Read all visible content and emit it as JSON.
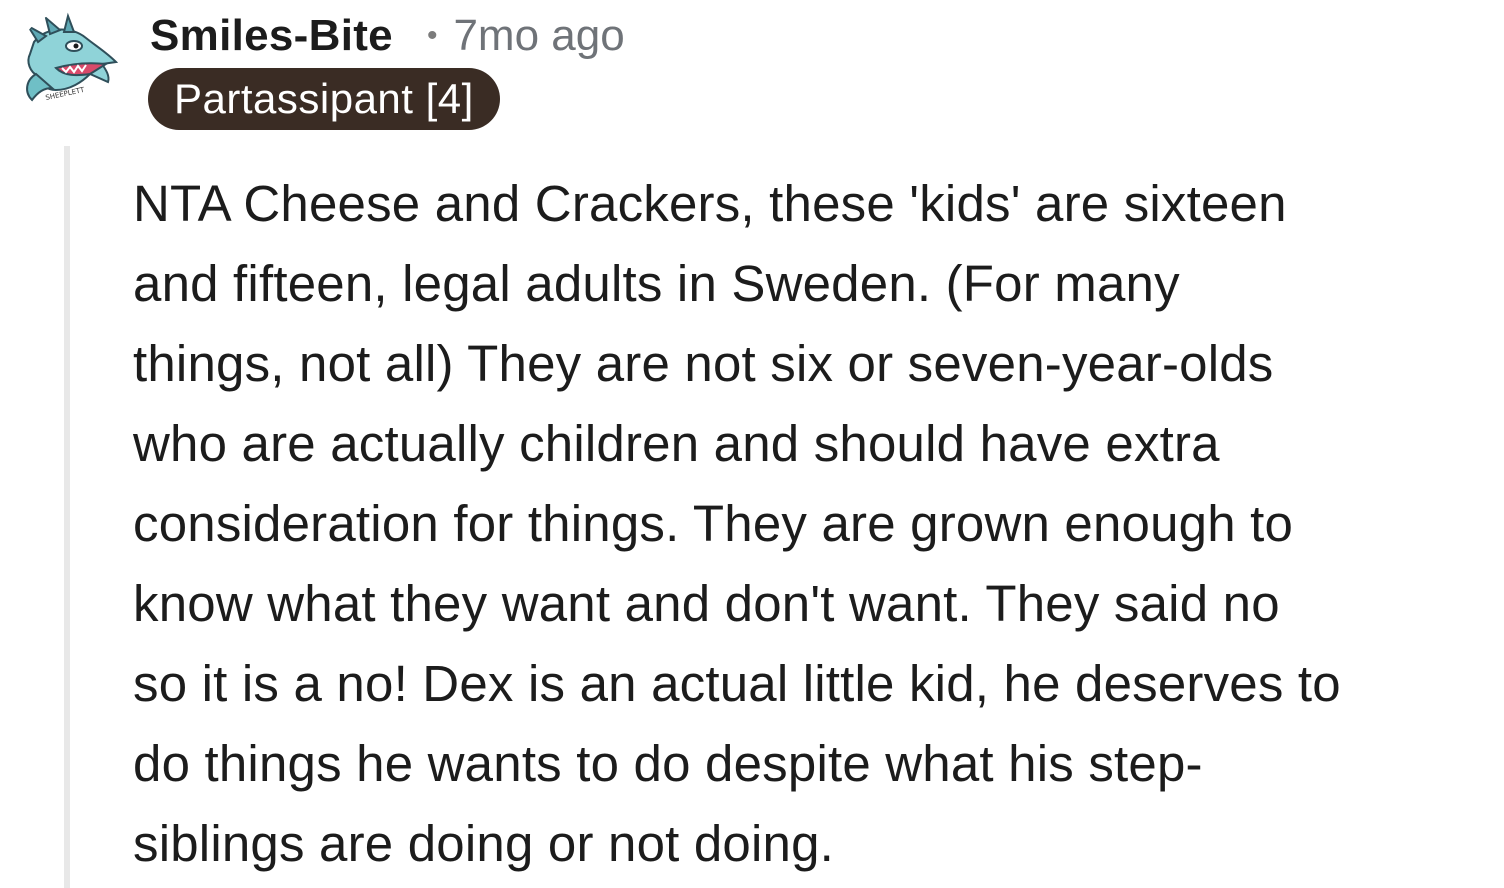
{
  "comment": {
    "author": {
      "username": "Smiles-Bite",
      "avatar_icon": "dragon-avatar-icon",
      "avatar_signature": "SHEEPLETT"
    },
    "separator": "•",
    "timestamp": "7mo ago",
    "flair": {
      "text": "Partassipant [4]",
      "background_color": "#3a2c24",
      "text_color": "#ffffff"
    },
    "body_lines": [
      "NTA Cheese and Crackers, these 'kids' are sixteen",
      "and fifteen, legal adults in Sweden. (For many",
      "things, not all) They are not six or seven-year-olds",
      "who are actually children and should have extra",
      "consideration for things. They are grown enough to",
      "know what they want and don't want. They said no",
      "so it is a no! Dex is an actual little kid, he deserves to",
      "do things he wants to do despite what his step-",
      "siblings are doing or not doing."
    ]
  }
}
